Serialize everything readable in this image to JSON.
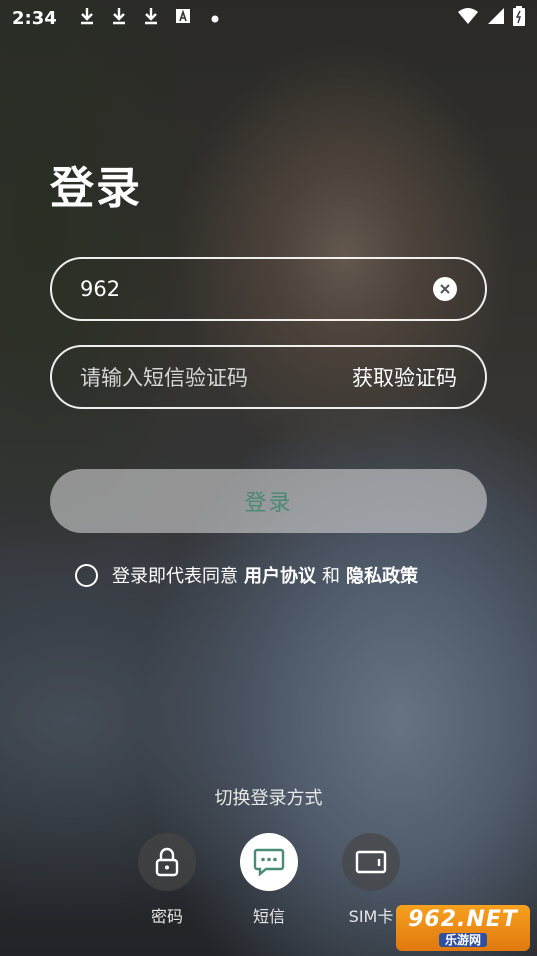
{
  "status_bar": {
    "time": "2:34",
    "icons": [
      "download-icon",
      "download-icon",
      "download-icon",
      "font-a-icon",
      "dot-icon"
    ],
    "right_icons": [
      "wifi-icon",
      "signal-icon",
      "battery-icon"
    ]
  },
  "page_title": "登录",
  "phone_field": {
    "value": "962"
  },
  "code_field": {
    "placeholder": "请输入短信验证码",
    "get_code_label": "获取验证码"
  },
  "login_button": {
    "label": "登录"
  },
  "agreement": {
    "prefix": "登录即代表同意",
    "user_agreement": "用户协议",
    "and": "和",
    "privacy_policy": "隐私政策"
  },
  "switch_method": {
    "label": "切换登录方式"
  },
  "login_options": [
    {
      "label": "密码",
      "icon": "lock-icon"
    },
    {
      "label": "短信",
      "icon": "sms-icon"
    },
    {
      "label": "SIM卡",
      "icon": "sim-card-icon"
    }
  ],
  "watermark": {
    "top": "962.NET",
    "bottom": "乐游网"
  },
  "colors": {
    "login_text": "#4b8a74",
    "watermark_orange": "#f39a1c"
  }
}
